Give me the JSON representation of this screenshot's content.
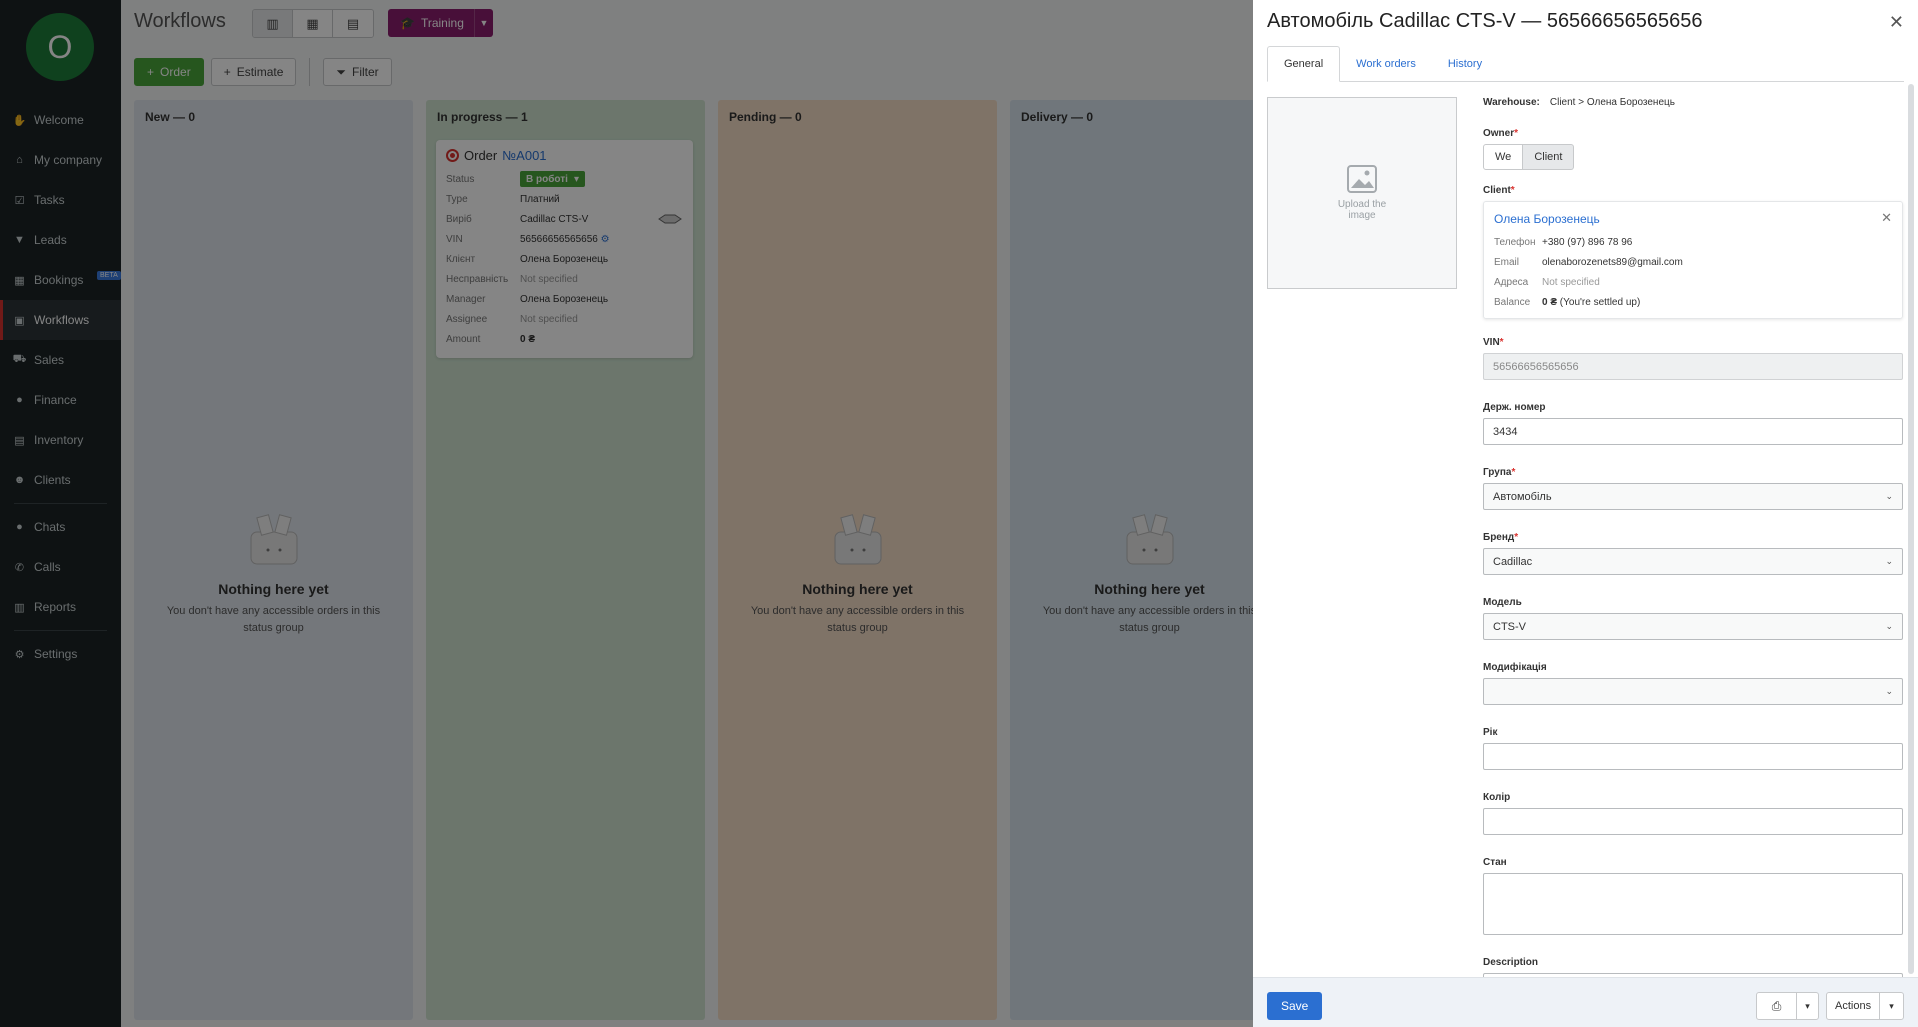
{
  "sidebar": {
    "avatar_letter": "O",
    "items": [
      {
        "label": "Welcome",
        "icon": "hand-icon"
      },
      {
        "label": "My company",
        "icon": "bank-icon"
      },
      {
        "label": "Tasks",
        "icon": "task-icon"
      },
      {
        "label": "Leads",
        "icon": "funnel-icon"
      },
      {
        "label": "Bookings",
        "icon": "calendar-icon",
        "badge": "BETA"
      },
      {
        "label": "Workflows",
        "icon": "workflow-icon",
        "active": true
      },
      {
        "label": "Sales",
        "icon": "cart-icon"
      },
      {
        "label": "Finance",
        "icon": "finance-icon"
      },
      {
        "label": "Inventory",
        "icon": "inventory-icon"
      },
      {
        "label": "Clients",
        "icon": "users-icon"
      },
      {
        "label": "Chats",
        "icon": "chat-icon"
      },
      {
        "label": "Calls",
        "icon": "phone-icon"
      },
      {
        "label": "Reports",
        "icon": "report-icon"
      },
      {
        "label": "Settings",
        "icon": "gear-icon"
      }
    ]
  },
  "header": {
    "title": "Workflows",
    "training_label": "Training"
  },
  "toolbar": {
    "order_label": "Order",
    "estimate_label": "Estimate",
    "filter_label": "Filter"
  },
  "columns": {
    "new": {
      "title": "New — 0"
    },
    "progress": {
      "title": "In progress — 1"
    },
    "pending": {
      "title": "Pending — 0"
    },
    "delivery": {
      "title": "Delivery — 0"
    }
  },
  "empty_state": {
    "title": "Nothing here yet",
    "text": "You don't have any accessible orders in this status group"
  },
  "card": {
    "prefix": "Order",
    "number": "№A001",
    "rows": {
      "status": {
        "k": "Status",
        "v": "В роботі"
      },
      "type": {
        "k": "Type",
        "v": "Платний"
      },
      "item": {
        "k": "Виріб",
        "v": "Cadillac CTS-V"
      },
      "vin": {
        "k": "VIN",
        "v": "56566656565656"
      },
      "client": {
        "k": "Клієнт",
        "v": "Олена Борозенець"
      },
      "fault": {
        "k": "Несправність",
        "v": "Not specified"
      },
      "manager": {
        "k": "Manager",
        "v": "Олена Борозенець"
      },
      "assignee": {
        "k": "Assignee",
        "v": "Not specified"
      },
      "amount": {
        "k": "Amount",
        "v": "0 ₴"
      }
    }
  },
  "panel": {
    "title": "Автомобіль Cadillac CTS-V — 56566656565656",
    "tabs": {
      "general": "General",
      "work_orders": "Work orders",
      "history": "History"
    },
    "upload_text": "Upload the image",
    "warehouse_label": "Warehouse:",
    "warehouse_value": "Client > Олена Борозенець",
    "owner_label": "Owner",
    "owner_options": {
      "we": "We",
      "client": "Client"
    },
    "client_label": "Client",
    "client": {
      "name": "Олена Борозенець",
      "phone_k": "Телефон",
      "phone_v": "+380 (97) 896 78 96",
      "email_k": "Email",
      "email_v": "olenaborozenets89@gmail.com",
      "address_k": "Адреса",
      "address_v": "Not specified",
      "balance_k": "Balance",
      "balance_amount": "0 ₴",
      "balance_note": "(You're settled up)"
    },
    "vin_label": "VIN",
    "vin_value": "56566656565656",
    "plate_label": "Держ. номер",
    "plate_value": "3434",
    "group_label": "Група",
    "group_value": "Автомобіль",
    "brand_label": "Бренд",
    "brand_value": "Cadillac",
    "model_label": "Модель",
    "model_value": "CTS-V",
    "mod_label": "Модифікація",
    "mod_value": "",
    "year_label": "Рік",
    "year_value": "",
    "color_label": "Колір",
    "color_value": "",
    "state_label": "Стан",
    "state_value": "",
    "desc_label": "Description",
    "desc_value": ""
  },
  "footer": {
    "save_label": "Save",
    "actions_label": "Actions"
  },
  "colors": {
    "sidebar_bg": "#1c2426",
    "accent_green": "#4aa53a",
    "training": "#8b1e6d",
    "link_blue": "#2b6fd1",
    "required_red": "#d9322f"
  }
}
